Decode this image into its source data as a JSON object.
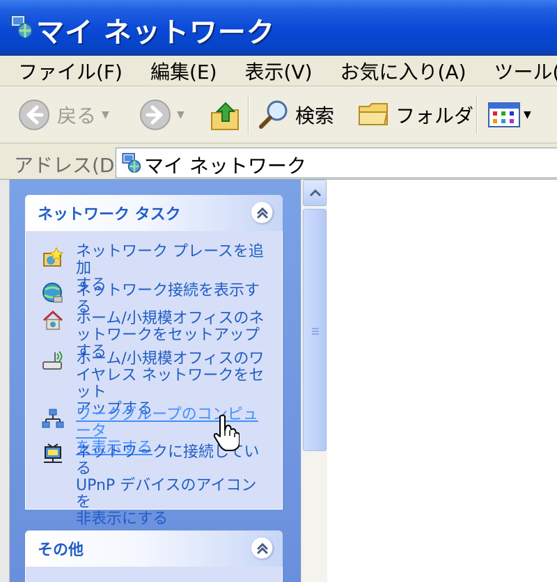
{
  "window": {
    "title": "マイ ネットワーク"
  },
  "menu": [
    "ファイル(F)",
    "編集(E)",
    "表示(V)",
    "お気に入り(A)",
    "ツール(T)"
  ],
  "toolbar": {
    "back_label": "戻る",
    "search_label": "検索",
    "folders_label": "フォルダ"
  },
  "address": {
    "label": "アドレス(D)",
    "value": "マイ ネットワーク"
  },
  "network_tasks": {
    "title": "ネットワーク タスク",
    "items": [
      {
        "icon": "add-network-place-icon",
        "lines": [
          "ネットワーク プレースを追加",
          "する"
        ]
      },
      {
        "icon": "network-connections-icon",
        "lines": [
          "ネットワーク接続を表示する"
        ]
      },
      {
        "icon": "home-network-icon",
        "lines": [
          "ホーム/小規模オフィスのネ",
          "ットワークをセットアップする"
        ]
      },
      {
        "icon": "wireless-network-icon",
        "lines": [
          "ホーム/小規模オフィスのワ",
          "イヤレス ネットワークをセット",
          "アップする"
        ]
      },
      {
        "icon": "workgroup-computers-icon",
        "lines": [
          "ワークグループのコンピュータ",
          "を表示する"
        ]
      },
      {
        "icon": "upnp-device-icon",
        "lines": [
          "ネットワークに接続している",
          "UPnP デバイスのアイコンを",
          "非表示にする"
        ]
      }
    ]
  },
  "other": {
    "title": "その他"
  },
  "colors": {
    "title_bar": "#0a48d6",
    "task_pane": "#6a8fdc",
    "link": "#215dc6",
    "link_hover": "#428eff"
  }
}
